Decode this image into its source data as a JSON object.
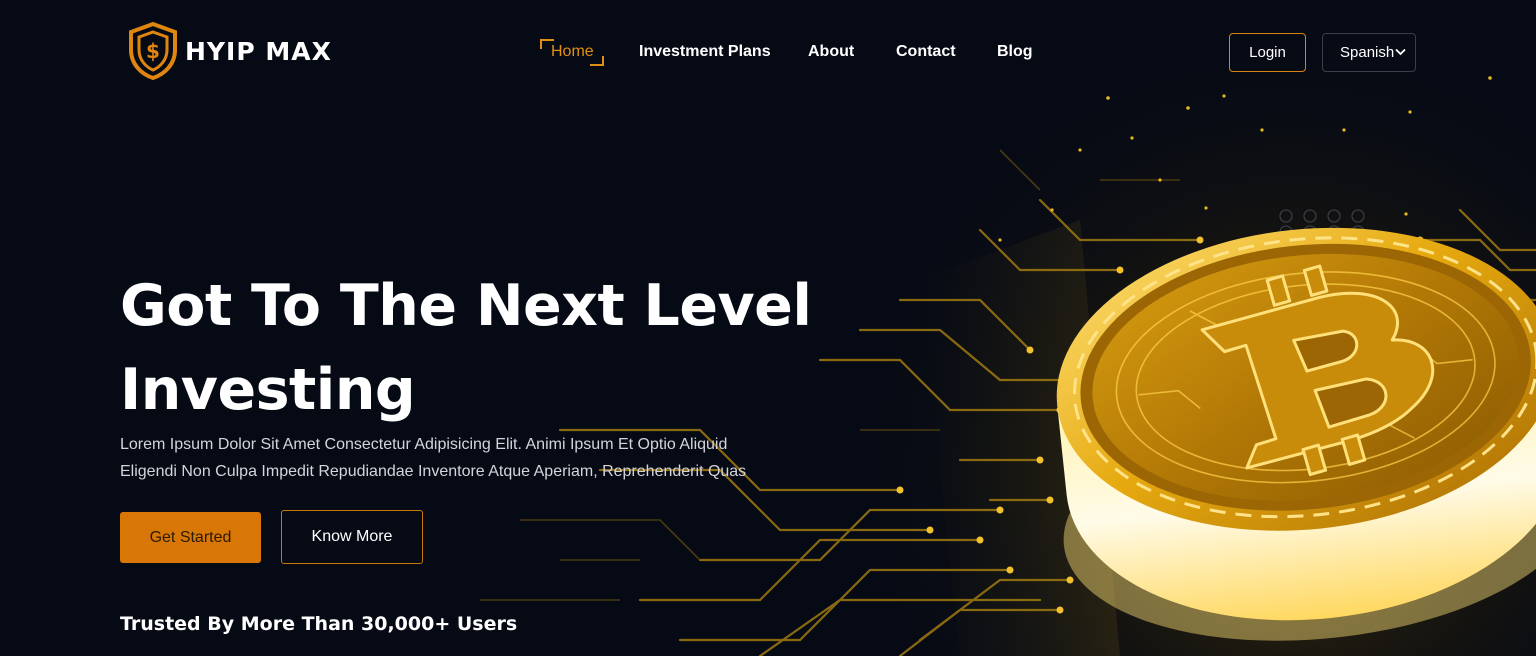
{
  "brand": {
    "name": "HYIP MAX",
    "logo_icon": "shield-dollar-icon",
    "accent_color": "#d97706"
  },
  "nav": {
    "items": [
      {
        "label": "Home",
        "active": true
      },
      {
        "label": "Investment Plans",
        "active": false
      },
      {
        "label": "About",
        "active": false
      },
      {
        "label": "Contact",
        "active": false
      },
      {
        "label": "Blog",
        "active": false
      }
    ]
  },
  "header": {
    "login_label": "Login",
    "language": {
      "selected": "Spanish",
      "icon": "chevron-down-icon"
    }
  },
  "hero": {
    "title_line1": "Got To The Next Level",
    "title_line2": "Investing",
    "description_line1": "Lorem Ipsum Dolor Sit Amet Consectetur Adipisicing Elit. Animi Ipsum Et Optio Aliquid",
    "description_line2": "Eligendi Non Culpa Impedit Repudiandae Inventore Atque Aperiam, Reprehenderit Quas",
    "primary_button": "Get Started",
    "secondary_button": "Know More",
    "trusted_text": "Trusted By More Than 30,000+ Users",
    "illustration": "golden-bitcoin-coin-on-circuit-board"
  },
  "colors": {
    "background": "#060a15",
    "accent": "#d97706",
    "gold": "#f5c518",
    "text": "#ffffff"
  }
}
